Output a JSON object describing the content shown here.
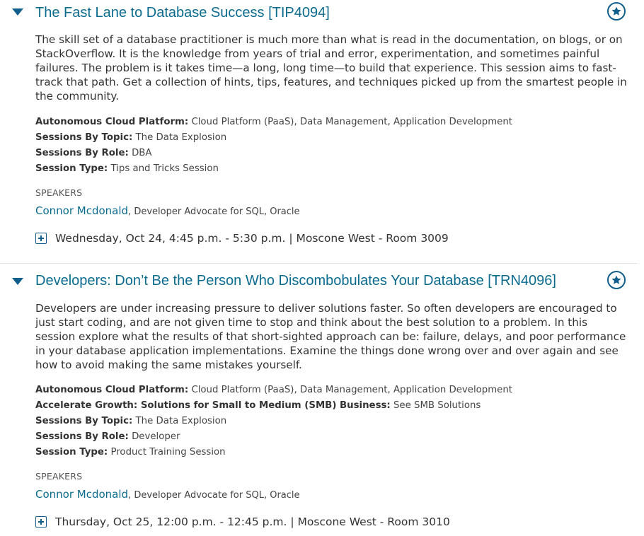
{
  "sessions": [
    {
      "title": "The Fast Lane to Database Success [TIP4094]",
      "description": "The skill set of a database practitioner is much more than what is read in the documentation, on blogs, or on StackOverflow. It is the knowledge from years of trial and error, experimentation, and sometimes painful failures. The problem is it takes time—a long, long time—to build that experience. This session aims to fast-track that path. Get a collection of hints, tips, features, and techniques picked up from the smartest people in the community.",
      "meta": [
        {
          "label": "Autonomous Cloud Platform:",
          "value": "Cloud Platform (PaaS), Data Management, Application Development"
        },
        {
          "label": "Sessions By Topic:",
          "value": "The Data Explosion"
        },
        {
          "label": "Sessions By Role:",
          "value": "DBA"
        },
        {
          "label": "Session Type:",
          "value": "Tips and Tricks Session"
        }
      ],
      "speakers_label": "SPEAKERS",
      "speaker_name": "Connor Mcdonald",
      "speaker_role": ", Developer Advocate for SQL, Oracle",
      "schedule": "Wednesday, Oct 24, 4:45 p.m. - 5:30 p.m. | Moscone West - Room 3009"
    },
    {
      "title": "Developers: Don’t Be the Person Who Discombobulates Your Database [TRN4096]",
      "description": "Developers are under increasing pressure to deliver solutions faster. So often developers are encouraged to just start coding, and are not given time to stop and think about the best solution to a problem. In this session explore what the results of that short-sighted approach can be: failure, delays, and poor performance in your database application implementations. Examine the things done wrong over and over again and see how to avoid making the same mistakes yourself.",
      "meta": [
        {
          "label": "Autonomous Cloud Platform:",
          "value": "Cloud Platform (PaaS), Data Management, Application Development"
        },
        {
          "label": "Accelerate Growth: Solutions for Small to Medium (SMB) Business:",
          "value": "See SMB Solutions"
        },
        {
          "label": "Sessions By Topic:",
          "value": "The Data Explosion"
        },
        {
          "label": "Sessions By Role:",
          "value": "Developer"
        },
        {
          "label": "Session Type:",
          "value": "Product Training Session"
        }
      ],
      "speakers_label": "SPEAKERS",
      "speaker_name": "Connor Mcdonald",
      "speaker_role": ", Developer Advocate for SQL, Oracle",
      "schedule": "Thursday, Oct 25, 12:00 p.m. - 12:45 p.m. | Moscone West - Room 3010"
    }
  ],
  "icons": {
    "expand": "caret-down-icon",
    "favorite": "star-icon",
    "add": "plus-square-icon"
  },
  "colors": {
    "accent": "#0f5e8c",
    "link": "#0b6b8f",
    "text": "#333333",
    "divider": "#e2e2e2"
  }
}
